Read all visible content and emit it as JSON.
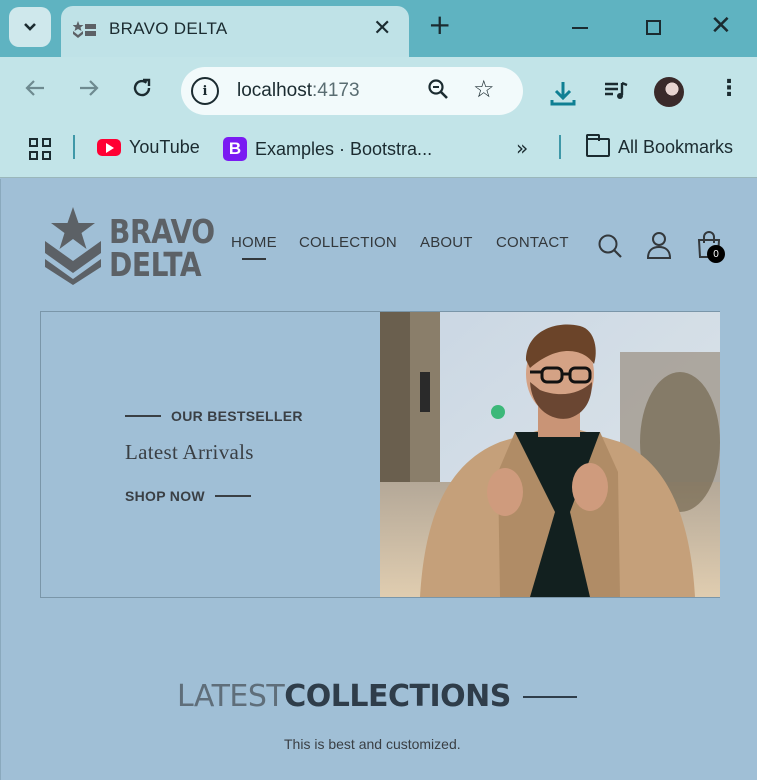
{
  "browser": {
    "tab_title": "BRAVO DELTA",
    "url_host": "localhost",
    "url_port": ":4173",
    "bookmarks": [
      {
        "label": "YouTube",
        "icon": "youtube-icon"
      },
      {
        "label": "Examples · Bootstra...",
        "icon": "bootstrap-icon"
      }
    ],
    "all_bookmarks_label": "All Bookmarks",
    "new_tab_symbol": "+",
    "close_symbol": "✕"
  },
  "site": {
    "logo": {
      "line1": "BRAVO",
      "line2": "DELTA"
    },
    "nav": [
      "HOME",
      "COLLECTION",
      "ABOUT",
      "CONTACT"
    ],
    "active_nav": "HOME",
    "cart_count": "0"
  },
  "hero": {
    "eyebrow": "OUR BESTSELLER",
    "title": "Latest Arrivals",
    "cta": "SHOP NOW"
  },
  "latest": {
    "title_light": "LATEST",
    "title_dark": "COLLECTIONS",
    "subtitle": "This is best and customized."
  },
  "colors": {
    "tabstrip": "#5fb3c1",
    "toolbar": "#c2e4e8",
    "page_bg": "#a0bfd6",
    "logo_gray": "#5c6166"
  }
}
